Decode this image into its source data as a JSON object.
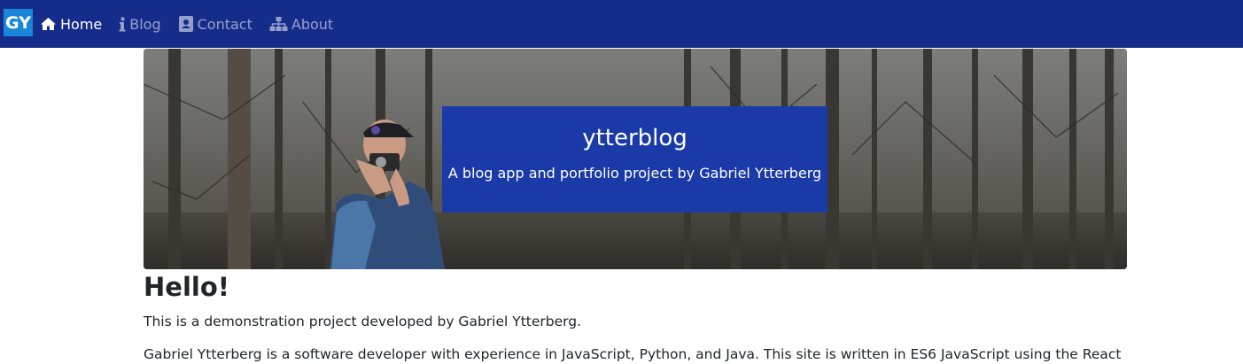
{
  "navbar": {
    "brand": "GY",
    "items": [
      {
        "label": "Home",
        "icon": "home-icon",
        "active": true
      },
      {
        "label": "Blog",
        "icon": "info-icon",
        "active": false
      },
      {
        "label": "Contact",
        "icon": "contact-card-icon",
        "active": false
      },
      {
        "label": "About",
        "icon": "sitemap-icon",
        "active": false
      }
    ]
  },
  "hero": {
    "title": "ytterblog",
    "subtitle": "A blog app and portfolio project by Gabriel Ytterberg"
  },
  "main": {
    "heading": "Hello!",
    "paragraph1": "This is a demonstration project developed by Gabriel Ytterberg.",
    "paragraph2": "Gabriel Ytterberg is a software developer with experience in JavaScript, Python, and Java. This site is written in ES6 JavaScript using the React"
  },
  "colors": {
    "navbar_bg": "#162c8a",
    "brand_bg": "#1a86d9",
    "hero_box_bg": "#1a3aa8"
  }
}
